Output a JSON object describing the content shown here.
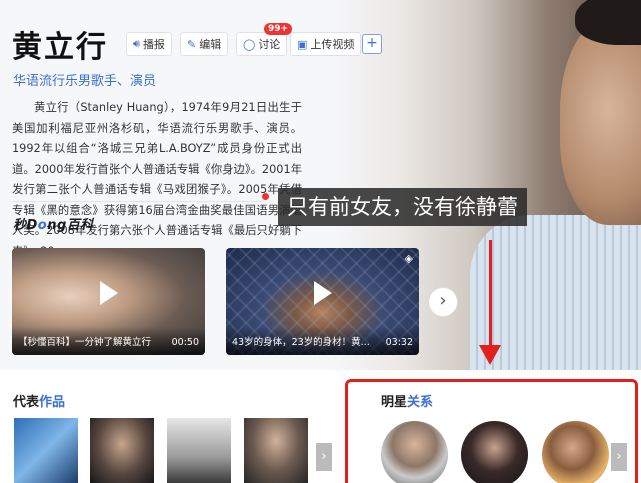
{
  "header": {
    "name": "黄立行",
    "subtitle": "华语流行乐男歌手、演员",
    "actions": {
      "play": "播报",
      "edit": "编辑",
      "discuss": "讨论",
      "discuss_badge": "99+",
      "upload_video": "上传视频",
      "add": "+"
    }
  },
  "summary": {
    "text": "黄立行（Stanley Huang），1974年9月21日出生于美国加利福尼亚州洛杉矶，华语流行乐男歌手、演员。1992年以组合“洛城三兄弟L.A.BOYZ”成员身份正式出道。2000年发行首张个人普通话专辑《你身边》。2001年发行第二张个人普通话专辑《马戏团猴子》。2005年凭借专辑《黑的意念》获得第16届台湾金曲奖最佳国语男演唱人奖。2008年发行第六张个人普通话专辑《最后只好躺下来》。20 ...",
    "more": ">>>"
  },
  "overlay_caption": "只有前女友，没有徐静蕾",
  "logo": {
    "prefix": "秒懂",
    "o": "ng",
    "suffix": "百科",
    "pre2": "秒D"
  },
  "videos": [
    {
      "title": "【秒懂百科】一分钟了解黄立行",
      "duration": "00:50"
    },
    {
      "title": "43岁的身体，23岁的身材！黄...",
      "duration": "03:32"
    }
  ],
  "works": {
    "title_plain": "代表",
    "title_blue": "作品",
    "next": "›"
  },
  "relations": {
    "title_plain": "明星",
    "title_blue": "关系",
    "next": "›"
  },
  "icons": {
    "play": "speaker-icon",
    "edit": "pencil-icon",
    "discuss": "chat-bubble-icon",
    "upload": "video-camera-icon",
    "next_video": "chevron-right-icon"
  },
  "colors": {
    "accent": "#3d6fd4",
    "annotation_red": "#e0201c"
  }
}
